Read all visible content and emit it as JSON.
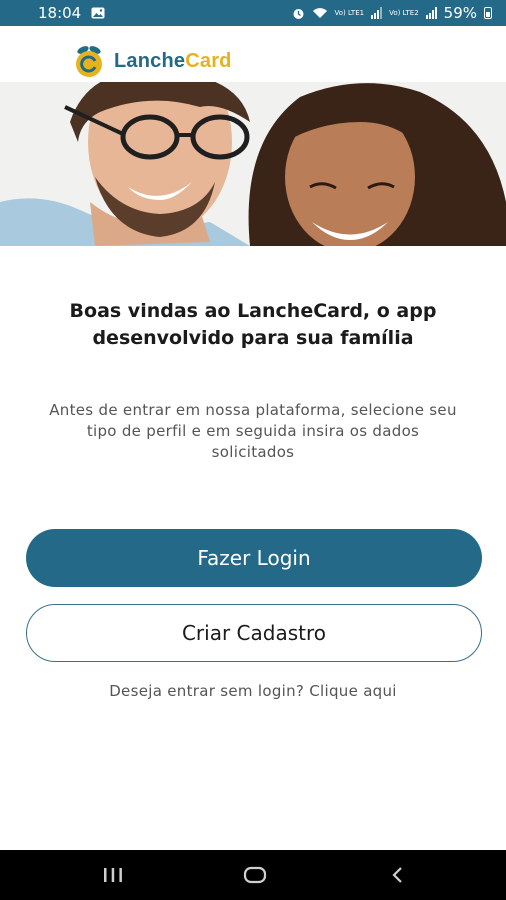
{
  "status_bar": {
    "time": "18:04",
    "sim1_label": "Vo) LTE1",
    "sim2_label": "Vo) LTE2",
    "battery": "59%",
    "icons": [
      "gallery-icon",
      "alarm-icon",
      "wifi-icon",
      "signal-icon",
      "battery-icon"
    ]
  },
  "brand": {
    "name_part1": "Lanche",
    "name_part2": "Card",
    "primary_color": "#246a88",
    "accent_color": "#e6b21e"
  },
  "welcome": {
    "title": "Boas vindas ao LancheCard, o app desenvolvido para sua família",
    "subtitle": "Antes de entrar em nossa plataforma, selecione seu tipo de perfil e em seguida insira os dados solicitados"
  },
  "actions": {
    "login_label": "Fazer Login",
    "signup_label": "Criar Cadastro",
    "guest_label": "Deseja entrar sem login? Clique aqui"
  },
  "nav": {
    "icons": [
      "recent-apps-icon",
      "home-icon",
      "back-icon"
    ]
  }
}
